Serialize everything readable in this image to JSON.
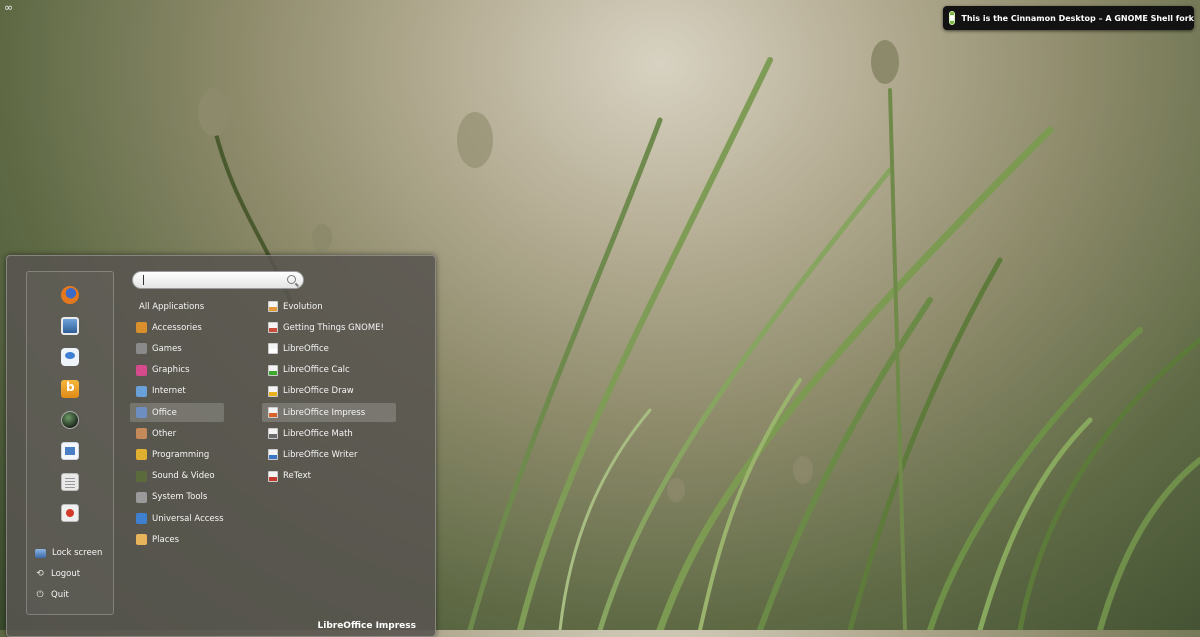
{
  "desktop": {
    "corner_icon": "link-icon",
    "notification": {
      "icon": "notification-info-icon",
      "text": "This is the Cinnamon Desktop – A GNOME Shell fork"
    }
  },
  "menu": {
    "favorites": [
      {
        "name": "firefox-icon"
      },
      {
        "name": "screenshot-icon"
      },
      {
        "name": "chat-icon"
      },
      {
        "name": "banshee-icon"
      },
      {
        "name": "globe-icon"
      },
      {
        "name": "libreoffice-writer-icon"
      },
      {
        "name": "document-icon"
      },
      {
        "name": "record-icon"
      }
    ],
    "system": {
      "lock": "Lock screen",
      "logout": "Logout",
      "quit": "Quit"
    },
    "search": {
      "value": "",
      "placeholder": ""
    },
    "categories": [
      {
        "label": "All Applications",
        "icon": ""
      },
      {
        "label": "Accessories",
        "icon": "accessories-icon",
        "color": "#d9902c"
      },
      {
        "label": "Games",
        "icon": "games-icon",
        "color": "#8a8a8a"
      },
      {
        "label": "Graphics",
        "icon": "graphics-icon",
        "color": "#d44a8a"
      },
      {
        "label": "Internet",
        "icon": "internet-icon",
        "color": "#6aa0d8"
      },
      {
        "label": "Office",
        "icon": "office-icon",
        "color": "#6d8ec0"
      },
      {
        "label": "Other",
        "icon": "other-icon",
        "color": "#c58a5a"
      },
      {
        "label": "Programming",
        "icon": "programming-icon",
        "color": "#e0b030"
      },
      {
        "label": "Sound & Video",
        "icon": "sound-video-icon",
        "color": "#5a6a3a"
      },
      {
        "label": "System Tools",
        "icon": "system-tools-icon",
        "color": "#9a9a9a"
      },
      {
        "label": "Universal Access",
        "icon": "universal-access-icon",
        "color": "#3f7fcf"
      },
      {
        "label": "Places",
        "icon": "places-icon",
        "color": "#e7b45c"
      }
    ],
    "selected_category": "Office",
    "applications": [
      {
        "label": "Evolution",
        "icon": "evolution-icon",
        "color": "#e39a3b"
      },
      {
        "label": "Getting Things GNOME!",
        "icon": "gtg-icon",
        "color": "#c94b3a"
      },
      {
        "label": "LibreOffice",
        "icon": "libreoffice-icon",
        "color": "#ffffff"
      },
      {
        "label": "LibreOffice Calc",
        "icon": "libreoffice-calc-icon",
        "color": "#3ea82f"
      },
      {
        "label": "LibreOffice Draw",
        "icon": "libreoffice-draw-icon",
        "color": "#e7b21e"
      },
      {
        "label": "LibreOffice Impress",
        "icon": "libreoffice-impress-icon",
        "color": "#d7632a"
      },
      {
        "label": "LibreOffice Math",
        "icon": "libreoffice-math-icon",
        "color": "#6a6a6a"
      },
      {
        "label": "LibreOffice Writer",
        "icon": "libreoffice-writer-icon",
        "color": "#3a76c6"
      },
      {
        "label": "ReText",
        "icon": "retext-icon",
        "color": "#c23a2c"
      }
    ],
    "selected_application": "LibreOffice Impress",
    "status_label": "LibreOffice Impress"
  }
}
